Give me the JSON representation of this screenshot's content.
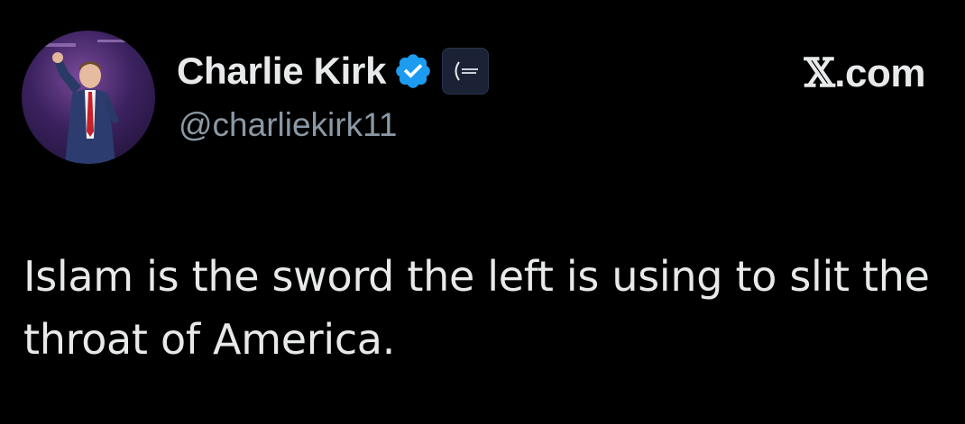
{
  "tweet": {
    "author": {
      "display_name": "Charlie Kirk",
      "handle": "@charliekirk11",
      "verified": true,
      "verified_icon": "verified-badge-icon",
      "affiliate_icon": "affiliate-org-logo-icon",
      "avatar_icon": "profile-photo"
    },
    "site": {
      "x_glyph": "𝕏",
      "domain": ".com"
    },
    "text": "Islam is the sword the left is using to slit the throat of America."
  },
  "colors": {
    "background": "#000000",
    "primary_text": "#e7e9ea",
    "secondary_text": "#8b98a5",
    "verified_blue": "#1d9bf0"
  }
}
